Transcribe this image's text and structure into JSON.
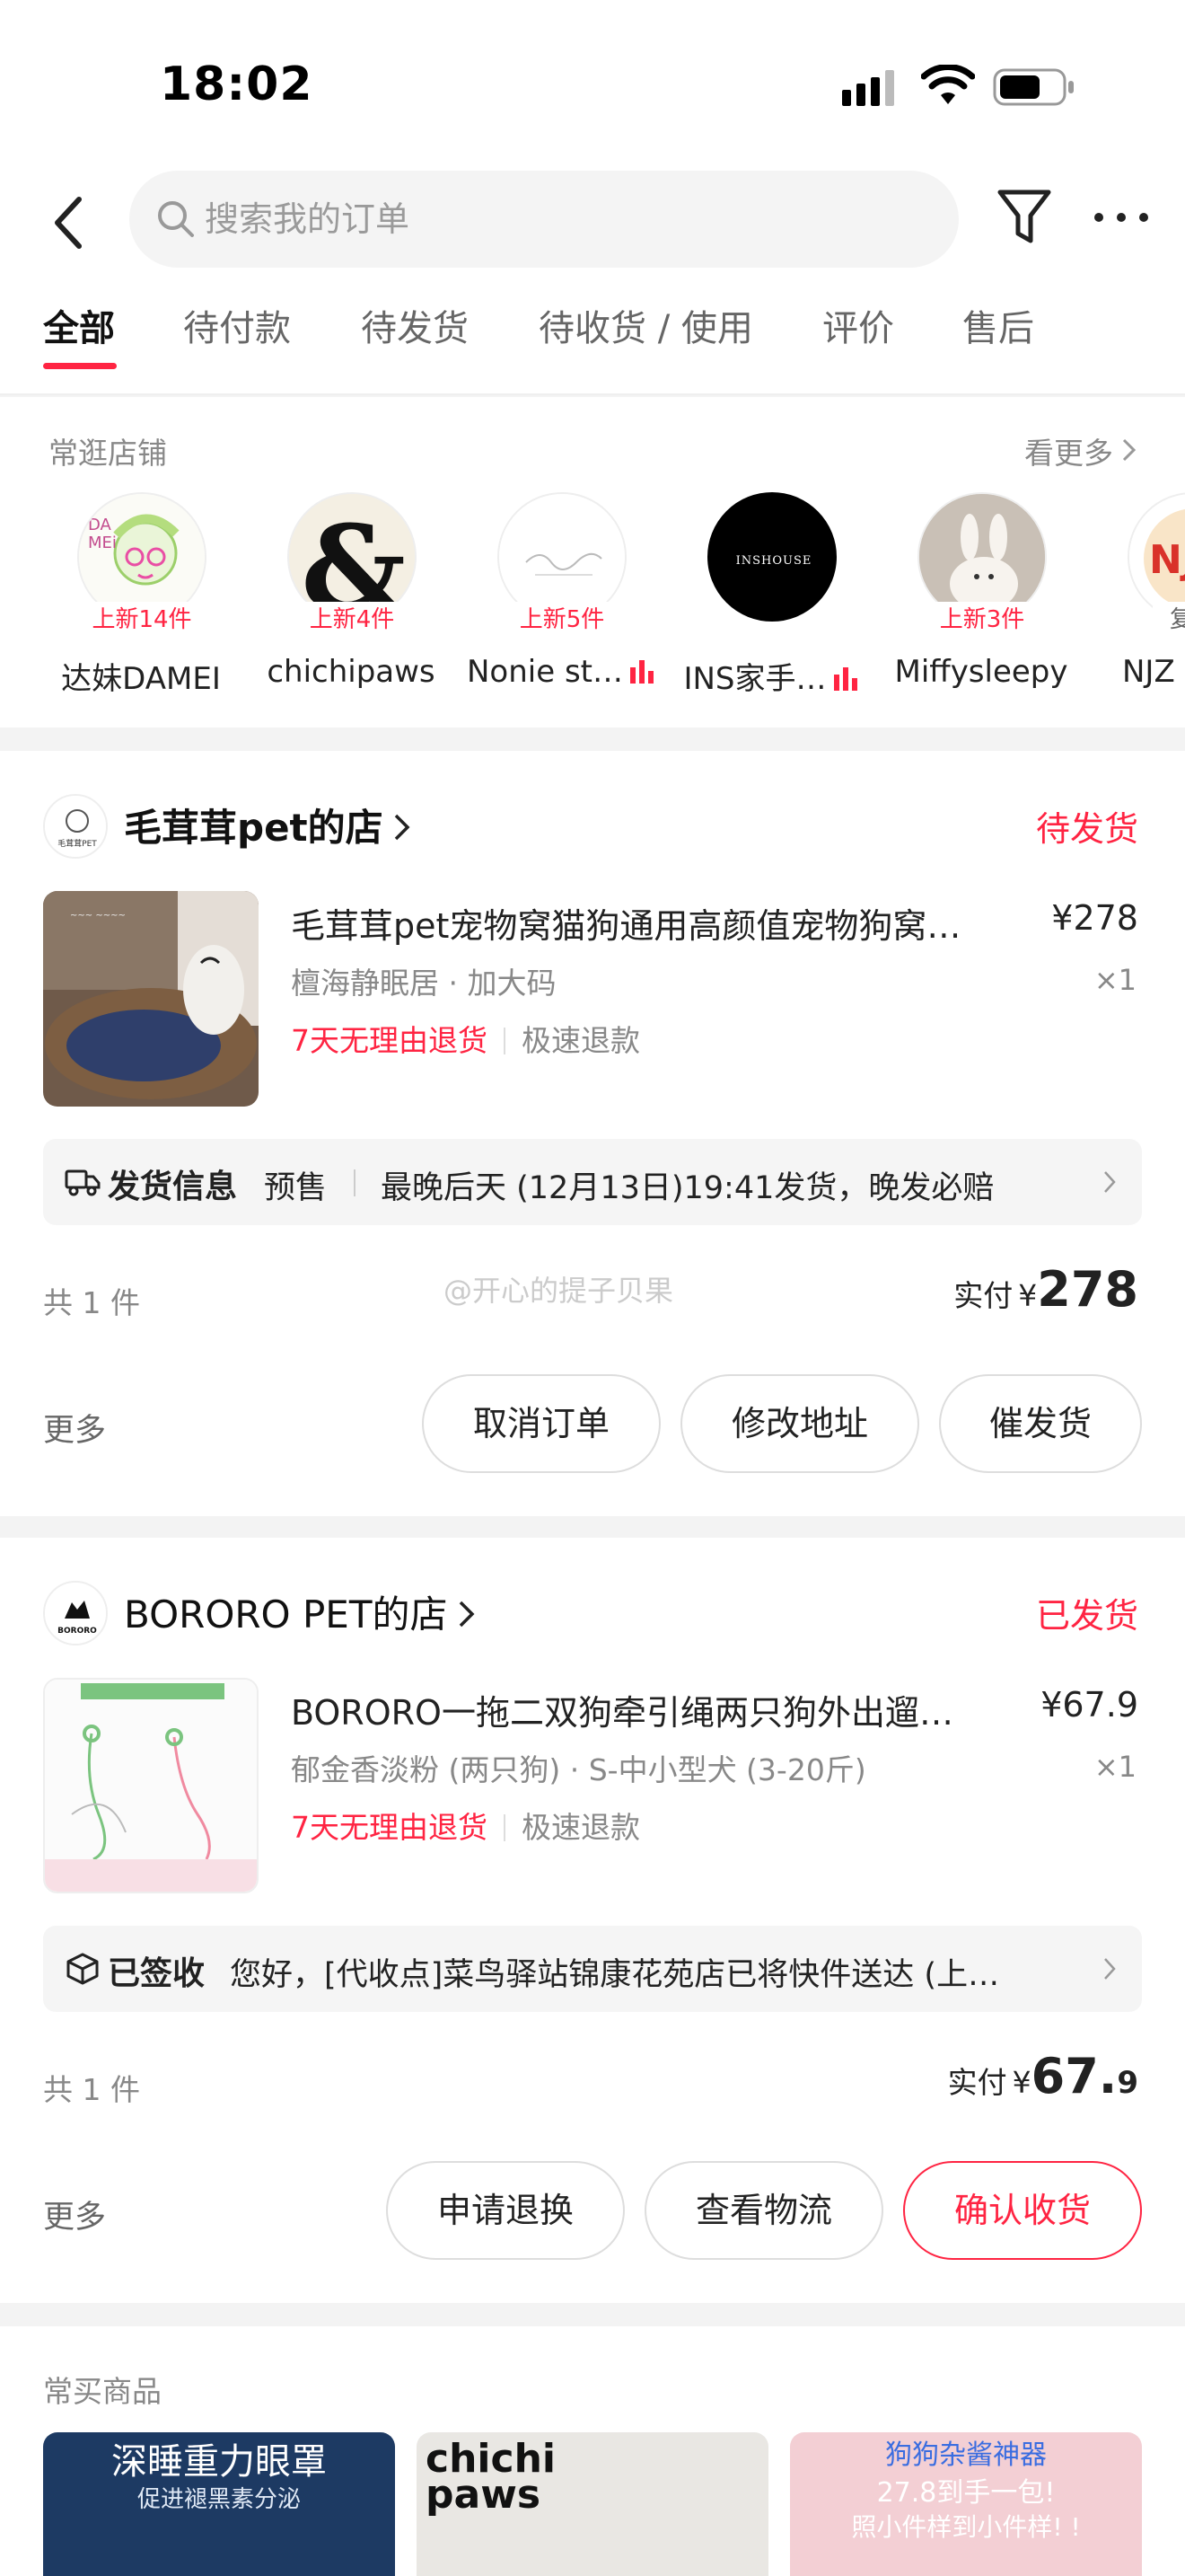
{
  "status_bar": {
    "time": "18:02"
  },
  "header": {
    "search": {
      "placeholder": "搜索我的订单"
    },
    "tabs": [
      {
        "label": "全部",
        "active": true
      },
      {
        "label": "待付款"
      },
      {
        "label": "待发货"
      },
      {
        "label": "待收货 / 使用"
      },
      {
        "label": "评价"
      },
      {
        "label": "售后"
      }
    ]
  },
  "frequent_shops": {
    "title": "常逛店铺",
    "more_label": "看更多",
    "shops": [
      {
        "name": "达妹DAMEI",
        "badge": "上新14件"
      },
      {
        "name": "chichipaws",
        "badge": "上新4件"
      },
      {
        "name": "Nonie st…",
        "badge": "上新5件",
        "live": true
      },
      {
        "name": "INS家手…",
        "live": true,
        "logo_text": "INSHOUSE"
      },
      {
        "name": "Miffysleepy",
        "badge": "上新3件"
      },
      {
        "name": "NJZ",
        "badge": "复购",
        "logo_text": "NJ"
      }
    ]
  },
  "orders": [
    {
      "store_name": "毛茸茸pet的店",
      "store_logo_text": "毛茸茸PET",
      "status": "待发货",
      "product": {
        "title": "毛茸茸pet宠物窝猫狗通用高颜值宠物狗窝…",
        "price": "¥278",
        "spec": "檀海静眠居 · 加大码",
        "qty": "×1",
        "tag_return": "7天无理由退货",
        "tag_refund": "极速退款"
      },
      "shipping": {
        "label": "发货信息",
        "presale": "预售",
        "text": "最晚后天 (12月13日)19:41发货，晚发必赔"
      },
      "total_count": "共 1 件",
      "paid_label": "实付",
      "paid_currency": "¥",
      "paid_amount": "278",
      "paid_decimal": "",
      "more_label": "更多",
      "actions": [
        "取消订单",
        "修改地址",
        "催发货"
      ]
    },
    {
      "store_name": "BORORO PET的店",
      "store_logo_text": "BORORO",
      "status": "已发货",
      "product": {
        "title": "BORORO一拖二双狗牵引绳两只狗外出遛…",
        "price": "¥67.9",
        "spec": "郁金香淡粉 (两只狗) · S-中小型犬 (3-20斤)",
        "qty": "×1",
        "tag_return": "7天无理由退货",
        "tag_refund": "极速退款"
      },
      "shipping": {
        "label": "已签收",
        "text": "您好，[代收点]菜鸟驿站锦康花苑店已将快件送达 (上…"
      },
      "total_count": "共 1 件",
      "paid_label": "实付",
      "paid_currency": "¥",
      "paid_amount": "67.",
      "paid_decimal": "9",
      "more_label": "更多",
      "actions": [
        "申请退换",
        "查看物流",
        "确认收货"
      ]
    }
  ],
  "watermark": "@开心的提子贝果",
  "frequent_items": {
    "title": "常买商品",
    "items": [
      {
        "line1": "深睡重力眼罩",
        "line2": "促进褪黑素分泌"
      },
      {
        "line1": "chichi",
        "line2": "paws"
      },
      {
        "line1": "狗狗杂酱神器",
        "line2": "27.8到手一包!",
        "line3": "照小件样到小件样! !"
      }
    ]
  },
  "colors": {
    "accent": "#ff2442",
    "text_muted": "#888888"
  }
}
